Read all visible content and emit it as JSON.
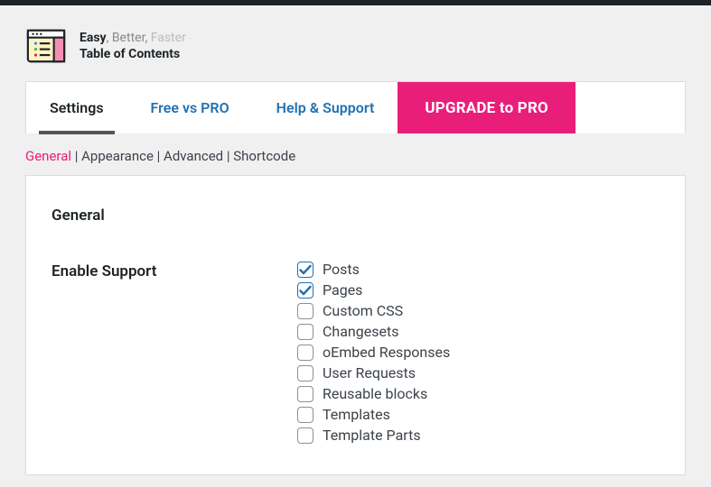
{
  "brand": {
    "tagline_easy": "Easy",
    "tagline_better": ", Better,",
    "tagline_faster": " Faster",
    "name": "Table of Contents"
  },
  "tabs": {
    "settings": "Settings",
    "free_vs_pro": "Free vs PRO",
    "help_support": "Help & Support",
    "upgrade": "UPGRADE to PRO"
  },
  "subnav": {
    "general": "General",
    "appearance": "Appearance",
    "advanced": "Advanced",
    "shortcode": "Shortcode",
    "sep": " | "
  },
  "section": {
    "title": "General",
    "enable_support_label": "Enable Support",
    "options": [
      {
        "label": "Posts",
        "checked": true
      },
      {
        "label": "Pages",
        "checked": true
      },
      {
        "label": "Custom CSS",
        "checked": false
      },
      {
        "label": "Changesets",
        "checked": false
      },
      {
        "label": "oEmbed Responses",
        "checked": false
      },
      {
        "label": "User Requests",
        "checked": false
      },
      {
        "label": "Reusable blocks",
        "checked": false
      },
      {
        "label": "Templates",
        "checked": false
      },
      {
        "label": "Template Parts",
        "checked": false
      }
    ]
  }
}
